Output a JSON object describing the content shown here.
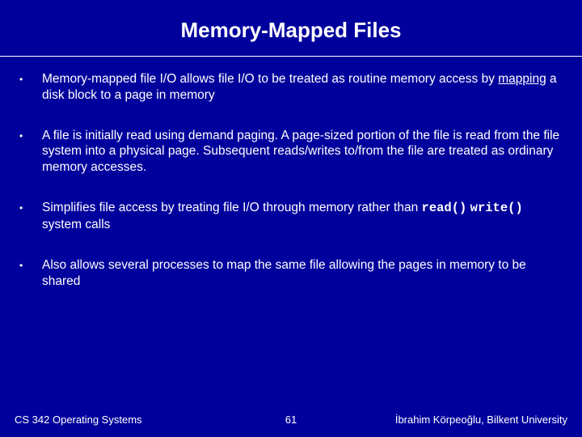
{
  "title": "Memory-Mapped Files",
  "bullets": [
    {
      "pre": "Memory-mapped file I/O allows file I/O to be treated as routine memory access by ",
      "underline": "mapping",
      "post": " a disk block to a page in memory"
    },
    {
      "text": "A file is initially read using demand paging. A page-sized portion of the file is read from the file system into a physical page. Subsequent reads/writes to/from the file are treated as ordinary memory accesses."
    },
    {
      "pre": "Simplifies file access by treating file I/O through memory rather than ",
      "code1": "read()",
      "mid": " ",
      "code2": "write()",
      "post": " system calls"
    },
    {
      "text": "Also allows several processes to map the same file allowing the pages in memory to be shared"
    }
  ],
  "footer": {
    "left": "CS 342 Operating Systems",
    "center": "61",
    "right": "İbrahim Körpeoğlu, Bilkent University"
  }
}
